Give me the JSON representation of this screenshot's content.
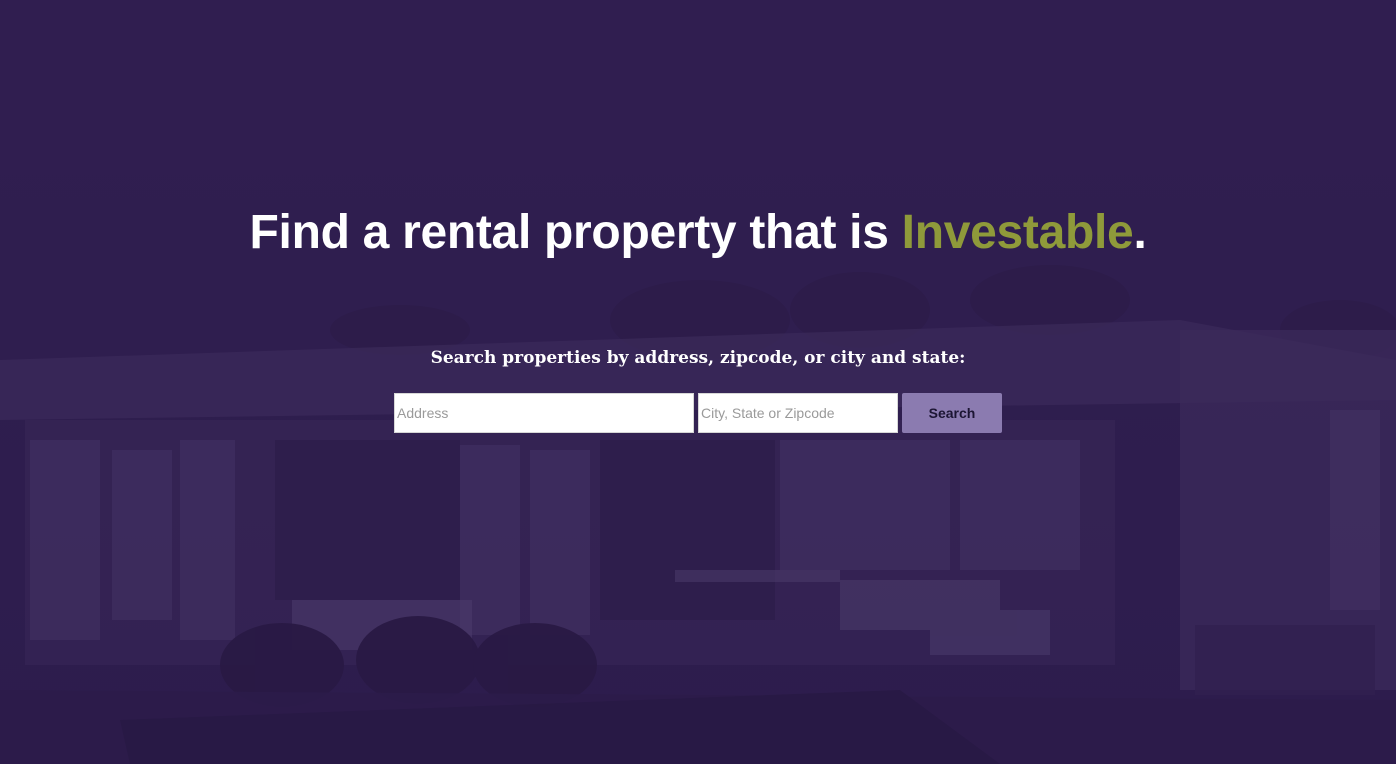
{
  "hero": {
    "headline_prefix": "Find a rental property that is ",
    "headline_accent": "Investable",
    "headline_suffix": ".",
    "subhead": "Search properties by address, zipcode, or city and state:"
  },
  "search": {
    "address_placeholder": "Address",
    "location_placeholder": "City, State or Zipcode",
    "button_label": "Search"
  },
  "colors": {
    "overlay": "#301e52",
    "accent": "#8f9a3a",
    "button": "#8b7bb0"
  }
}
